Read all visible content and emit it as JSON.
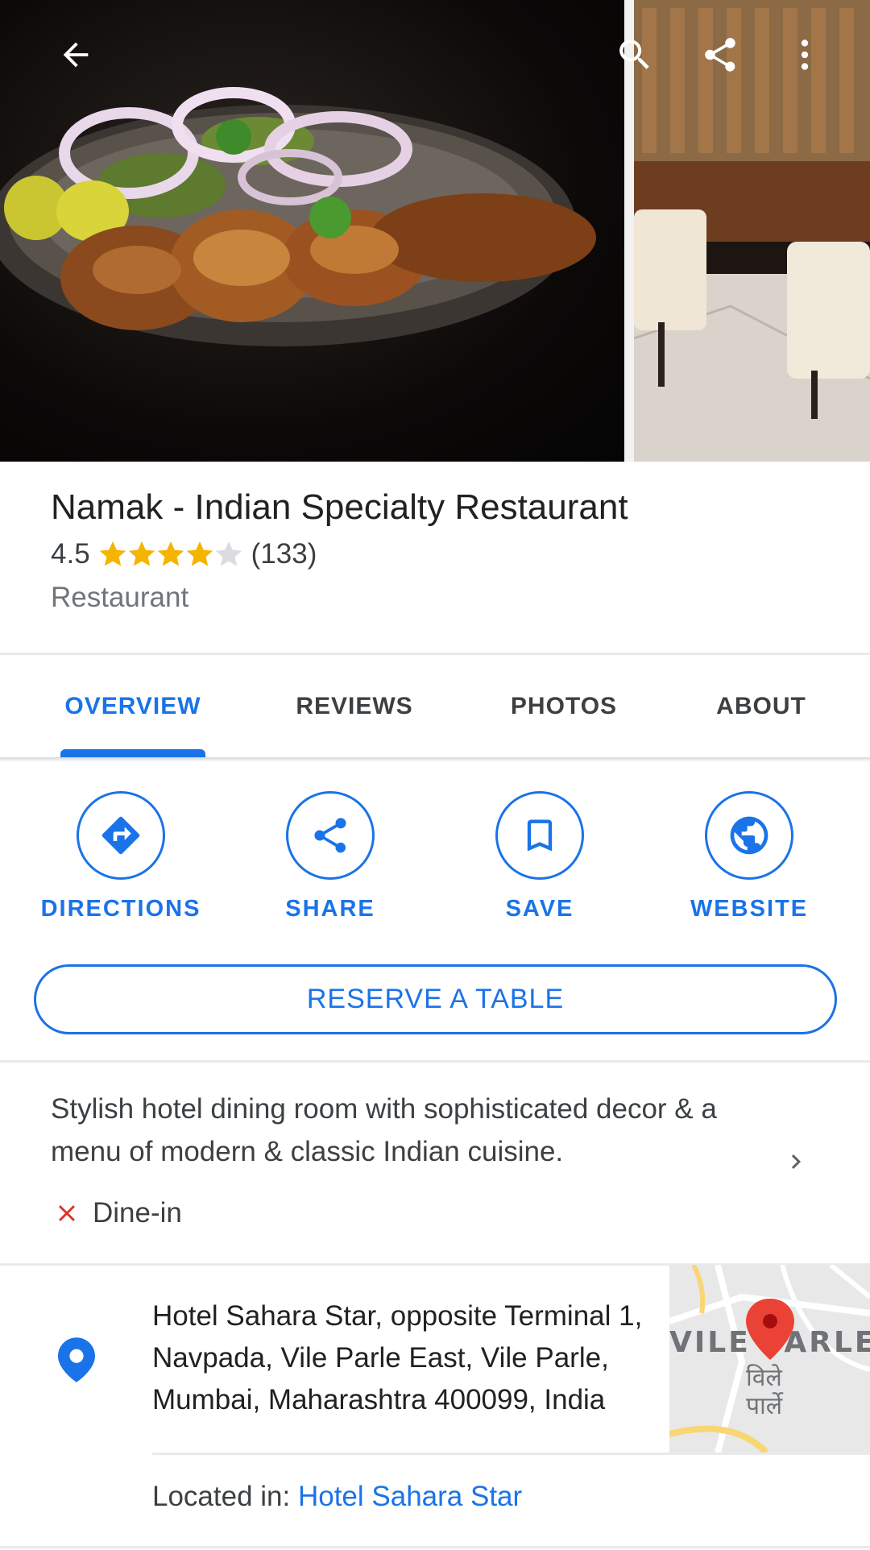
{
  "place": {
    "name": "Namak - Indian Specialty Restaurant",
    "rating": "4.5",
    "rating_value": 4.5,
    "review_count": "(133)",
    "category": "Restaurant"
  },
  "tabs": [
    {
      "label": "OVERVIEW",
      "active": true
    },
    {
      "label": "REVIEWS",
      "active": false
    },
    {
      "label": "PHOTOS",
      "active": false
    },
    {
      "label": "ABOUT",
      "active": false
    }
  ],
  "actions": [
    {
      "label": "DIRECTIONS",
      "icon": "directions-icon"
    },
    {
      "label": "SHARE",
      "icon": "share-icon"
    },
    {
      "label": "SAVE",
      "icon": "bookmark-icon"
    },
    {
      "label": "WEBSITE",
      "icon": "globe-icon"
    }
  ],
  "reserve_label": "RESERVE A TABLE",
  "description": "Stylish hotel dining room with sophisticated decor & a menu of modern & classic Indian cuisine.",
  "service_option": {
    "label": "Dine-in",
    "available": false
  },
  "address": "Hotel Sahara Star, opposite Terminal 1, Navpada, Vile Parle East, Vile Parle, Mumbai, Maharashtra 400099, India",
  "located_in": {
    "prefix": "Located in: ",
    "link": "Hotel Sahara Star"
  },
  "map": {
    "label_latin": "VILE PARLE",
    "label_devanagari_1": "विले",
    "label_devanagari_2": "पार्ले"
  },
  "colors": {
    "accent": "#1a73e8",
    "star": "#f4b400",
    "error": "#d93025",
    "pin": "#ea4335"
  }
}
